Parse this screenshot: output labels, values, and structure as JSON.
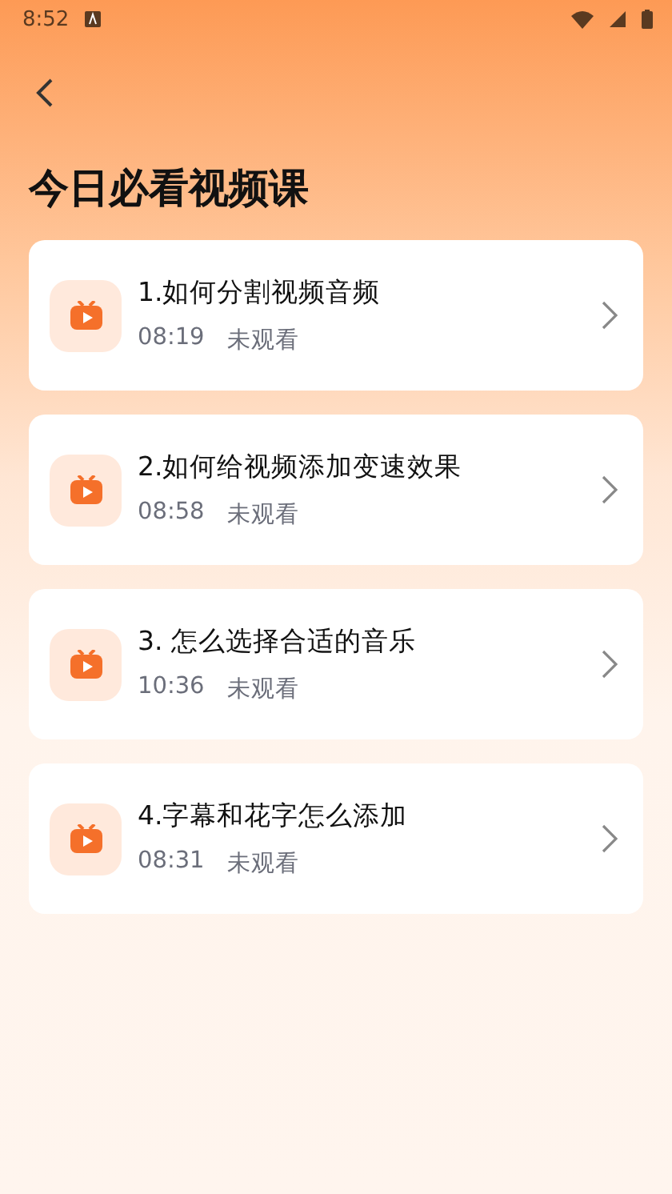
{
  "status_bar": {
    "time": "8:52"
  },
  "title": "今日必看视频课",
  "lessons": [
    {
      "title": "1.如何分割视频音频",
      "duration": "08:19",
      "status": "未观看"
    },
    {
      "title": "2.如何给视频添加变速效果",
      "duration": "08:58",
      "status": "未观看"
    },
    {
      "title": "3. 怎么选择合适的音乐",
      "duration": "10:36",
      "status": "未观看"
    },
    {
      "title": "4.字幕和花字怎么添加",
      "duration": "08:31",
      "status": "未观看"
    }
  ]
}
